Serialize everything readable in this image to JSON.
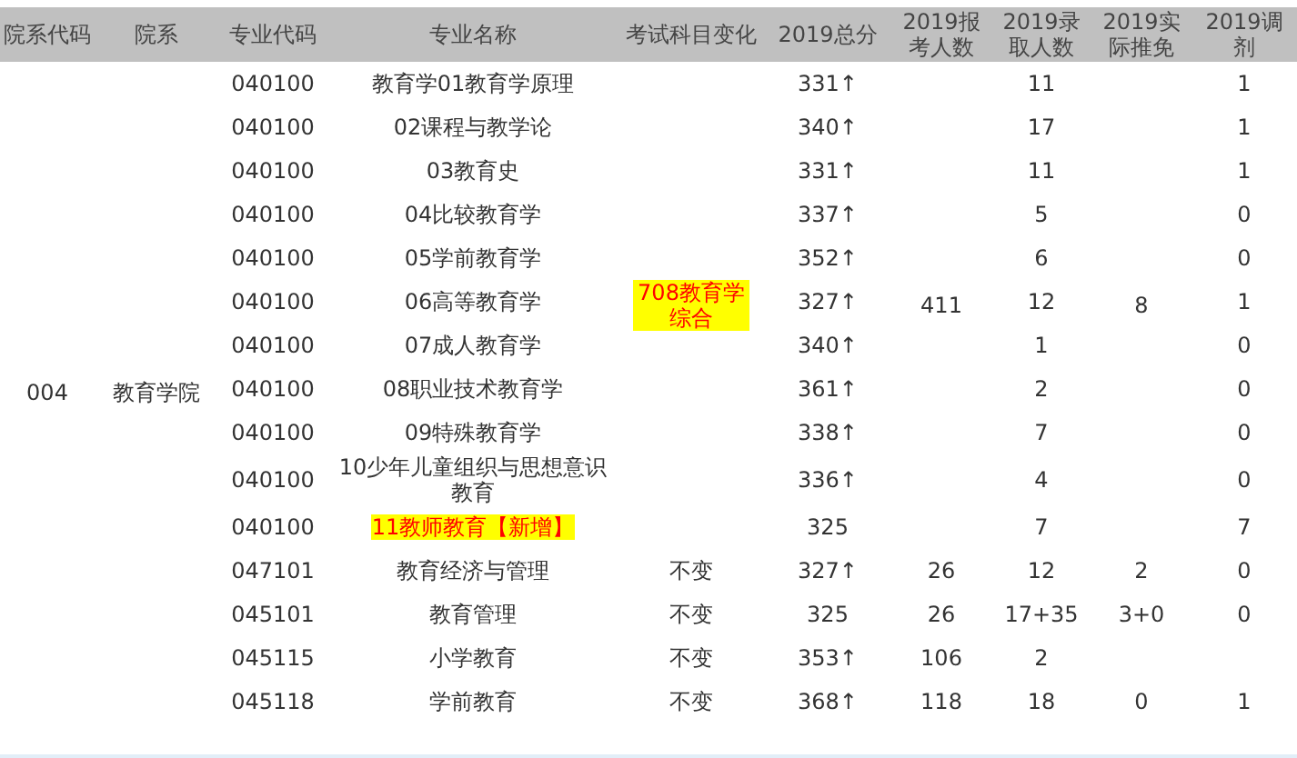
{
  "columns": [
    "院系代码",
    "院系",
    "专业代码",
    "专业名称",
    "考试科目变化",
    "2019总分",
    "2019报考人数",
    "2019录取人数",
    "2019实际推免",
    "2019调剂"
  ],
  "department": {
    "code": "004",
    "name": "教育学院"
  },
  "groups": [
    {
      "exam_change": "708教育学综合",
      "exam_change_highlighted": true,
      "applicants": "411",
      "exempted": "8",
      "rows": [
        {
          "code": "040100",
          "name": "教育学01教育学原理",
          "highlighted": false,
          "total": "331↑",
          "admitted": "11",
          "adjusted": "1"
        },
        {
          "code": "040100",
          "name": "02课程与教学论",
          "highlighted": false,
          "total": "340↑",
          "admitted": "17",
          "adjusted": "1"
        },
        {
          "code": "040100",
          "name": "03教育史",
          "highlighted": false,
          "total": "331↑",
          "admitted": "11",
          "adjusted": "1"
        },
        {
          "code": "040100",
          "name": "04比较教育学",
          "highlighted": false,
          "total": "337↑",
          "admitted": "5",
          "adjusted": "0"
        },
        {
          "code": "040100",
          "name": "05学前教育学",
          "highlighted": false,
          "total": "352↑",
          "admitted": "6",
          "adjusted": "0"
        },
        {
          "code": "040100",
          "name": "06高等教育学",
          "highlighted": false,
          "total": "327↑",
          "admitted": "12",
          "adjusted": "1"
        },
        {
          "code": "040100",
          "name": "07成人教育学",
          "highlighted": false,
          "total": "340↑",
          "admitted": "1",
          "adjusted": "0"
        },
        {
          "code": "040100",
          "name": "08职业技术教育学",
          "highlighted": false,
          "total": "361↑",
          "admitted": "2",
          "adjusted": "0"
        },
        {
          "code": "040100",
          "name": "09特殊教育学",
          "highlighted": false,
          "total": "338↑",
          "admitted": "7",
          "adjusted": "0"
        },
        {
          "code": "040100",
          "name": "10少年儿童组织与思想意识教育",
          "highlighted": false,
          "total": "336↑",
          "admitted": "4",
          "adjusted": "0"
        },
        {
          "code": "040100",
          "name": "11教师教育【新增】",
          "highlighted": true,
          "total": "325",
          "admitted": "7",
          "adjusted": "7"
        }
      ]
    },
    {
      "exam_change": "不变",
      "exam_change_highlighted": false,
      "applicants": "26",
      "exempted": "2",
      "rows": [
        {
          "code": "047101",
          "name": "教育经济与管理",
          "highlighted": false,
          "total": "327↑",
          "admitted": "12",
          "adjusted": "0"
        }
      ]
    },
    {
      "exam_change": "不变",
      "exam_change_highlighted": false,
      "applicants": "26",
      "exempted": "3+0",
      "rows": [
        {
          "code": "045101",
          "name": "教育管理",
          "highlighted": false,
          "total": "325",
          "admitted": "17+35",
          "adjusted": "0"
        }
      ]
    },
    {
      "exam_change": "不变",
      "exam_change_highlighted": false,
      "applicants": "106",
      "rows": [
        {
          "code": "045115",
          "name": "小学教育",
          "highlighted": false,
          "total": "353↑",
          "admitted": "2"
        }
      ]
    },
    {
      "exam_change": "不变",
      "exam_change_highlighted": false,
      "applicants": "118",
      "exempted": "0",
      "rows": [
        {
          "code": "045118",
          "name": "学前教育",
          "highlighted": false,
          "total": "368↑",
          "admitted": "18",
          "adjusted": "1"
        }
      ]
    }
  ]
}
